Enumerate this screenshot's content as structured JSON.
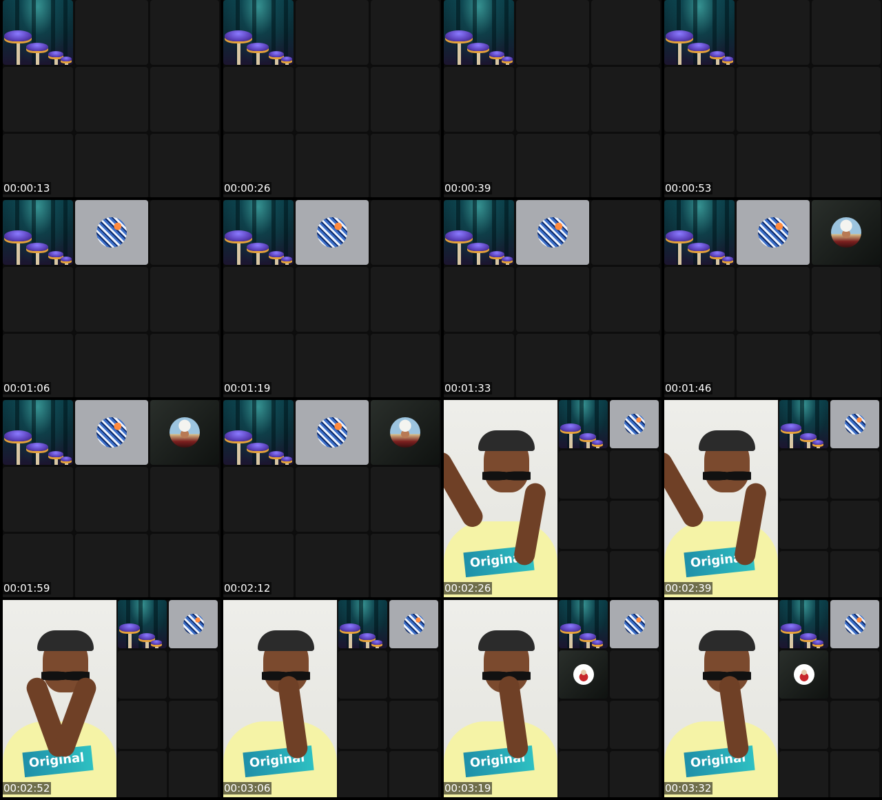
{
  "frames": [
    {
      "timestamp": "00:00:13",
      "layout": "grid",
      "tiles": [
        "forest",
        "blank",
        "blank",
        "blank",
        "blank",
        "blank",
        "blank",
        "blank",
        "blank"
      ]
    },
    {
      "timestamp": "00:00:26",
      "layout": "grid",
      "tiles": [
        "forest",
        "blank",
        "blank",
        "blank",
        "blank",
        "blank",
        "blank",
        "blank",
        "blank"
      ]
    },
    {
      "timestamp": "00:00:39",
      "layout": "grid",
      "tiles": [
        "forest",
        "blank",
        "blank",
        "blank",
        "blank",
        "blank",
        "blank",
        "blank",
        "blank"
      ]
    },
    {
      "timestamp": "00:00:53",
      "layout": "grid",
      "tiles": [
        "forest",
        "blank",
        "blank",
        "blank",
        "blank",
        "blank",
        "blank",
        "blank",
        "blank"
      ]
    },
    {
      "timestamp": "00:01:06",
      "layout": "grid",
      "tiles": [
        "forest",
        "sketch",
        "blank",
        "blank",
        "blank",
        "blank",
        "blank",
        "blank",
        "blank"
      ]
    },
    {
      "timestamp": "00:01:19",
      "layout": "grid",
      "tiles": [
        "forest",
        "sketch",
        "blank",
        "blank",
        "blank",
        "blank",
        "blank",
        "blank",
        "blank"
      ]
    },
    {
      "timestamp": "00:01:33",
      "layout": "grid",
      "tiles": [
        "forest",
        "sketch",
        "blank",
        "blank",
        "blank",
        "blank",
        "blank",
        "blank",
        "blank"
      ]
    },
    {
      "timestamp": "00:01:46",
      "layout": "grid",
      "tiles": [
        "forest",
        "sketch",
        "man",
        "blank",
        "blank",
        "blank",
        "blank",
        "blank",
        "blank"
      ]
    },
    {
      "timestamp": "00:01:59",
      "layout": "grid",
      "tiles": [
        "forest",
        "sketch",
        "man",
        "blank",
        "blank",
        "blank",
        "blank",
        "blank",
        "blank"
      ]
    },
    {
      "timestamp": "00:02:12",
      "layout": "grid",
      "tiles": [
        "forest",
        "sketch",
        "man",
        "blank",
        "blank",
        "blank",
        "blank",
        "blank",
        "blank"
      ]
    },
    {
      "timestamp": "00:02:26",
      "layout": "presenter",
      "pose": "wave",
      "tiles": [
        "forest",
        "sketch",
        "blank",
        "blank",
        "blank",
        "blank",
        "blank",
        "blank"
      ]
    },
    {
      "timestamp": "00:02:39",
      "layout": "presenter",
      "pose": "wave",
      "tiles": [
        "forest",
        "sketch",
        "blank",
        "blank",
        "blank",
        "blank",
        "blank",
        "blank"
      ]
    },
    {
      "timestamp": "00:02:52",
      "layout": "presenter",
      "pose": "hands",
      "tiles": [
        "forest",
        "sketch",
        "blank",
        "blank",
        "blank",
        "blank",
        "blank",
        "blank"
      ]
    },
    {
      "timestamp": "00:03:06",
      "layout": "presenter",
      "pose": "chin",
      "tiles": [
        "forest",
        "sketch",
        "blank",
        "blank",
        "blank",
        "blank",
        "blank",
        "blank"
      ]
    },
    {
      "timestamp": "00:03:19",
      "layout": "presenter",
      "pose": "chin",
      "tiles": [
        "forest",
        "sketch",
        "logo",
        "blank",
        "blank",
        "blank",
        "blank",
        "blank"
      ]
    },
    {
      "timestamp": "00:03:32",
      "layout": "presenter",
      "pose": "chin",
      "tiles": [
        "forest",
        "sketch",
        "logo",
        "blank",
        "blank",
        "blank",
        "blank",
        "blank"
      ]
    }
  ],
  "shirt_text": "Original",
  "colors": {
    "background": "#000000",
    "tile": "#1a1a1a",
    "timestamp_text": "#ffffff"
  }
}
